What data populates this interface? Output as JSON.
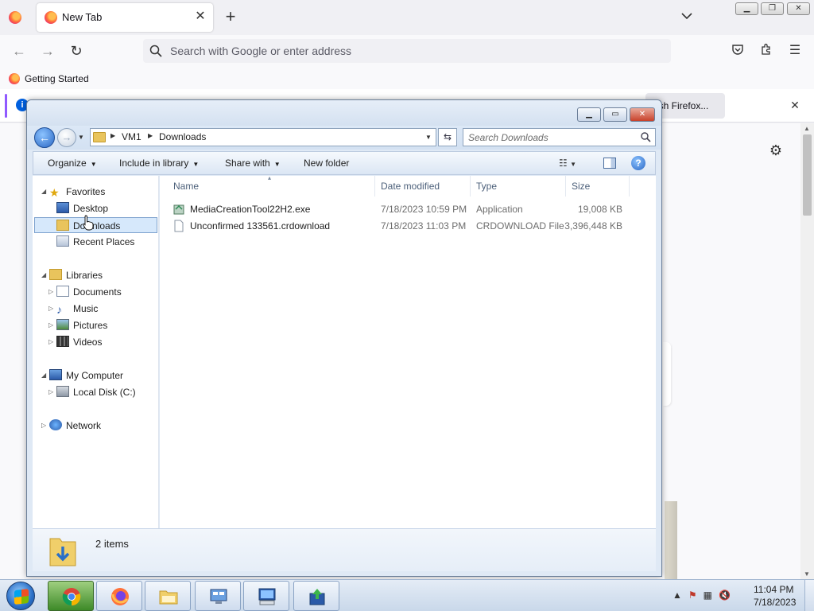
{
  "browser": {
    "tab_title": "New Tab",
    "new_tab_symbol": "+",
    "url_placeholder": "Search with Google or enter address",
    "bookmark": "Getting Started",
    "notice_button": "resh Firefox..."
  },
  "explorer": {
    "breadcrumb": [
      "VM1",
      "Downloads"
    ],
    "search_placeholder": "Search Downloads",
    "commands": {
      "organize": "Organize",
      "include": "Include in library",
      "share": "Share with",
      "new_folder": "New folder"
    },
    "nav": {
      "favorites": "Favorites",
      "desktop": "Desktop",
      "downloads": "Downloads",
      "recent": "Recent Places",
      "libraries": "Libraries",
      "documents": "Documents",
      "music": "Music",
      "pictures": "Pictures",
      "videos": "Videos",
      "my_computer": "My Computer",
      "local_disk": "Local Disk (C:)",
      "network": "Network"
    },
    "columns": {
      "name": "Name",
      "date": "Date modified",
      "type": "Type",
      "size": "Size"
    },
    "files": [
      {
        "name": "MediaCreationTool22H2.exe",
        "date": "7/18/2023 10:59 PM",
        "type": "Application",
        "size": "19,008 KB"
      },
      {
        "name": "Unconfirmed 133561.crdownload",
        "date": "7/18/2023 11:03 PM",
        "type": "CRDOWNLOAD File",
        "size": "3,396,448 KB"
      }
    ],
    "item_count": "2 items"
  },
  "taskbar": {
    "time": "11:04 PM",
    "date": "7/18/2023",
    "apps": [
      "chrome-icon",
      "firefox-icon",
      "explorer-icon",
      "network-settings-icon",
      "virtual-machine-icon",
      "file-transfer-icon"
    ]
  },
  "colors": {
    "accent": "#9059ff",
    "selection": "#d6e8fb",
    "title_gradient": "#d3e0f0"
  }
}
